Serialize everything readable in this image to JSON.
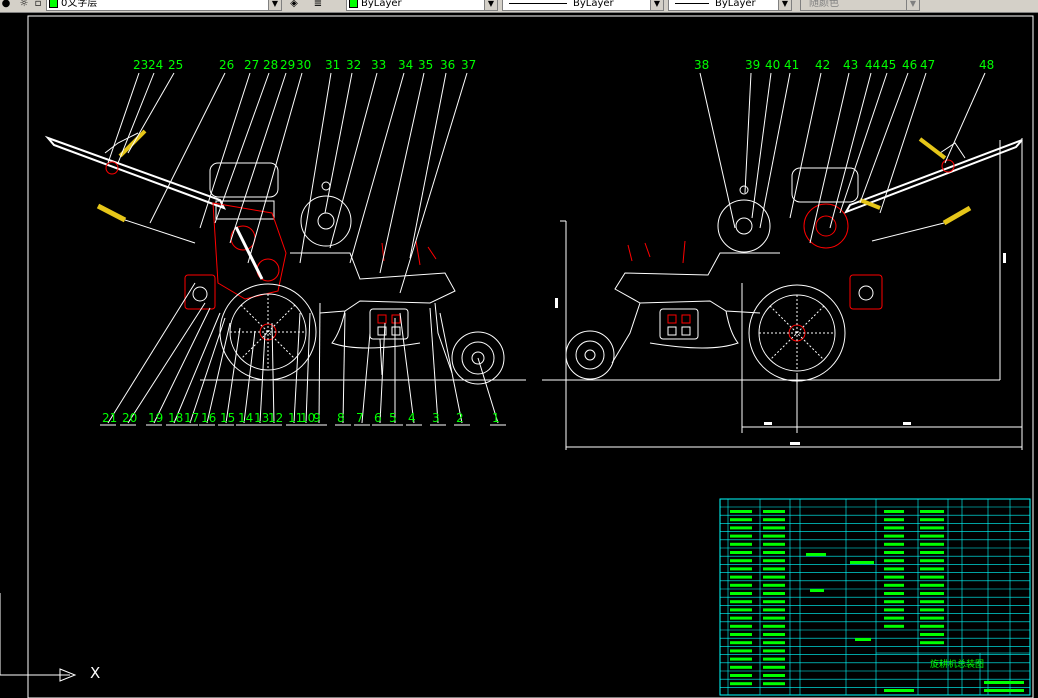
{
  "toolbar": {
    "layer_name": "0文字层",
    "color_label": "ByLayer",
    "linetype_label": "ByLayer",
    "lineweight_label": "ByLayer",
    "plotstyle_label": "随颜色"
  },
  "drawing": {
    "background_color": "#000000",
    "callout_color": "#00ff00",
    "table_color": "#00ffff",
    "machine_color": "#ffffff",
    "accent_color": "#ff0000",
    "hatch_color": "#e6c619",
    "left_view_top_callouts": [
      "23",
      "24",
      "25",
      "26",
      "27",
      "28",
      "29",
      "30",
      "31",
      "32",
      "33",
      "34",
      "35",
      "36",
      "37"
    ],
    "left_view_bottom_callouts": [
      "21",
      "20",
      "19",
      "18",
      "17",
      "16",
      "15",
      "14",
      "13",
      "12",
      "11",
      "10",
      "9",
      "8",
      "7",
      "6",
      "5",
      "4",
      "3",
      "2",
      "1"
    ],
    "right_view_top_callouts": [
      "38",
      "39",
      "40",
      "41",
      "42",
      "43",
      "44",
      "45",
      "46",
      "47",
      "48"
    ],
    "title_block_title": "旋耕机总装图",
    "ucs_x_label": "X"
  }
}
